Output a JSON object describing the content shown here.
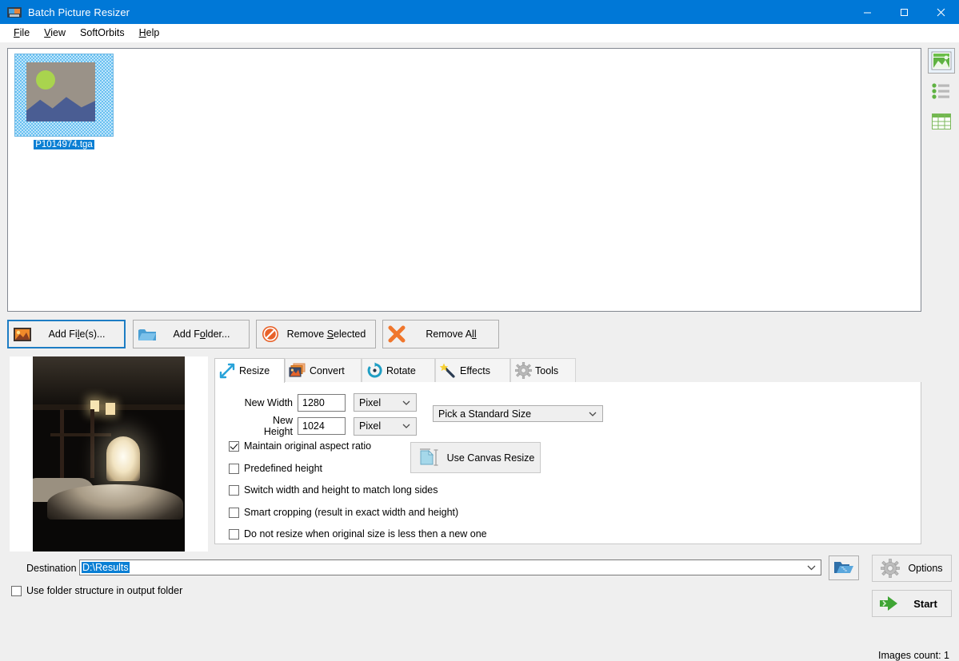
{
  "window": {
    "title": "Batch Picture Resizer",
    "icon": "app-picture-icon",
    "minimize": "minimize",
    "maximize": "maximize",
    "close": "close"
  },
  "menubar": {
    "items": [
      {
        "label": "File",
        "mnemonic": "F"
      },
      {
        "label": "View",
        "mnemonic": "V"
      },
      {
        "label": "SoftOrbits",
        "mnemonic": ""
      },
      {
        "label": "Help",
        "mnemonic": "H"
      }
    ]
  },
  "filelist": {
    "items": [
      {
        "filename": "P1014974.tga",
        "selected": true
      }
    ],
    "count_label": "Images count:  1"
  },
  "viewbar": {
    "buttons": [
      {
        "name": "thumbnail-view",
        "selected": true
      },
      {
        "name": "list-view",
        "selected": false
      },
      {
        "name": "details-view",
        "selected": false
      }
    ]
  },
  "toolbar": {
    "add_files": "Add File(s)...",
    "add_files_pre": "Add Fi",
    "add_files_mn": "l",
    "add_files_post": "e(s)...",
    "add_folder_pre": "Add F",
    "add_folder_mn": "o",
    "add_folder_post": "lder...",
    "remove_selected_pre": "Remove ",
    "remove_selected_mn": "S",
    "remove_selected_post": "elected",
    "remove_all_pre": "Remove A",
    "remove_all_mn": "ll",
    "remove_all_post": ""
  },
  "tabs": [
    {
      "label": "Resize",
      "icon": "resize-arrows-icon",
      "active": true
    },
    {
      "label": "Convert",
      "icon": "convert-images-icon",
      "active": false
    },
    {
      "label": "Rotate",
      "icon": "rotate-circle-icon",
      "active": false
    },
    {
      "label": "Effects",
      "icon": "magic-wand-icon",
      "active": false
    },
    {
      "label": "Tools",
      "icon": "gear-icon",
      "active": false
    }
  ],
  "resize_tab": {
    "new_width_label": "New Width",
    "new_width_value": "1280",
    "new_width_unit": "Pixel",
    "new_height_label": "New Height",
    "new_height_value": "1024",
    "new_height_unit": "Pixel",
    "standard_size_value": "Pick a Standard Size",
    "canvas_resize_label": "Use Canvas Resize",
    "checkboxes": [
      {
        "label": "Maintain original aspect ratio",
        "checked": true
      },
      {
        "label": "Predefined height",
        "checked": false
      },
      {
        "label": "Switch width and height to match long sides",
        "checked": false
      },
      {
        "label": "Smart cropping (result in exact width and height)",
        "checked": false
      },
      {
        "label": "Do not resize when original size is less then a new one",
        "checked": false
      }
    ]
  },
  "footer": {
    "destination_label": "Destination",
    "destination_value": "D:\\Results",
    "use_folder_structure_label": "Use folder structure in output folder",
    "use_folder_structure_checked": false,
    "options_label": "Options",
    "start_label": "Start"
  },
  "colors": {
    "titlebar": "#0078d7",
    "selection": "#0a7fd4",
    "accent_green": "#3fa535",
    "window_bg": "#efefef",
    "focus_border": "#1d7dc4"
  }
}
